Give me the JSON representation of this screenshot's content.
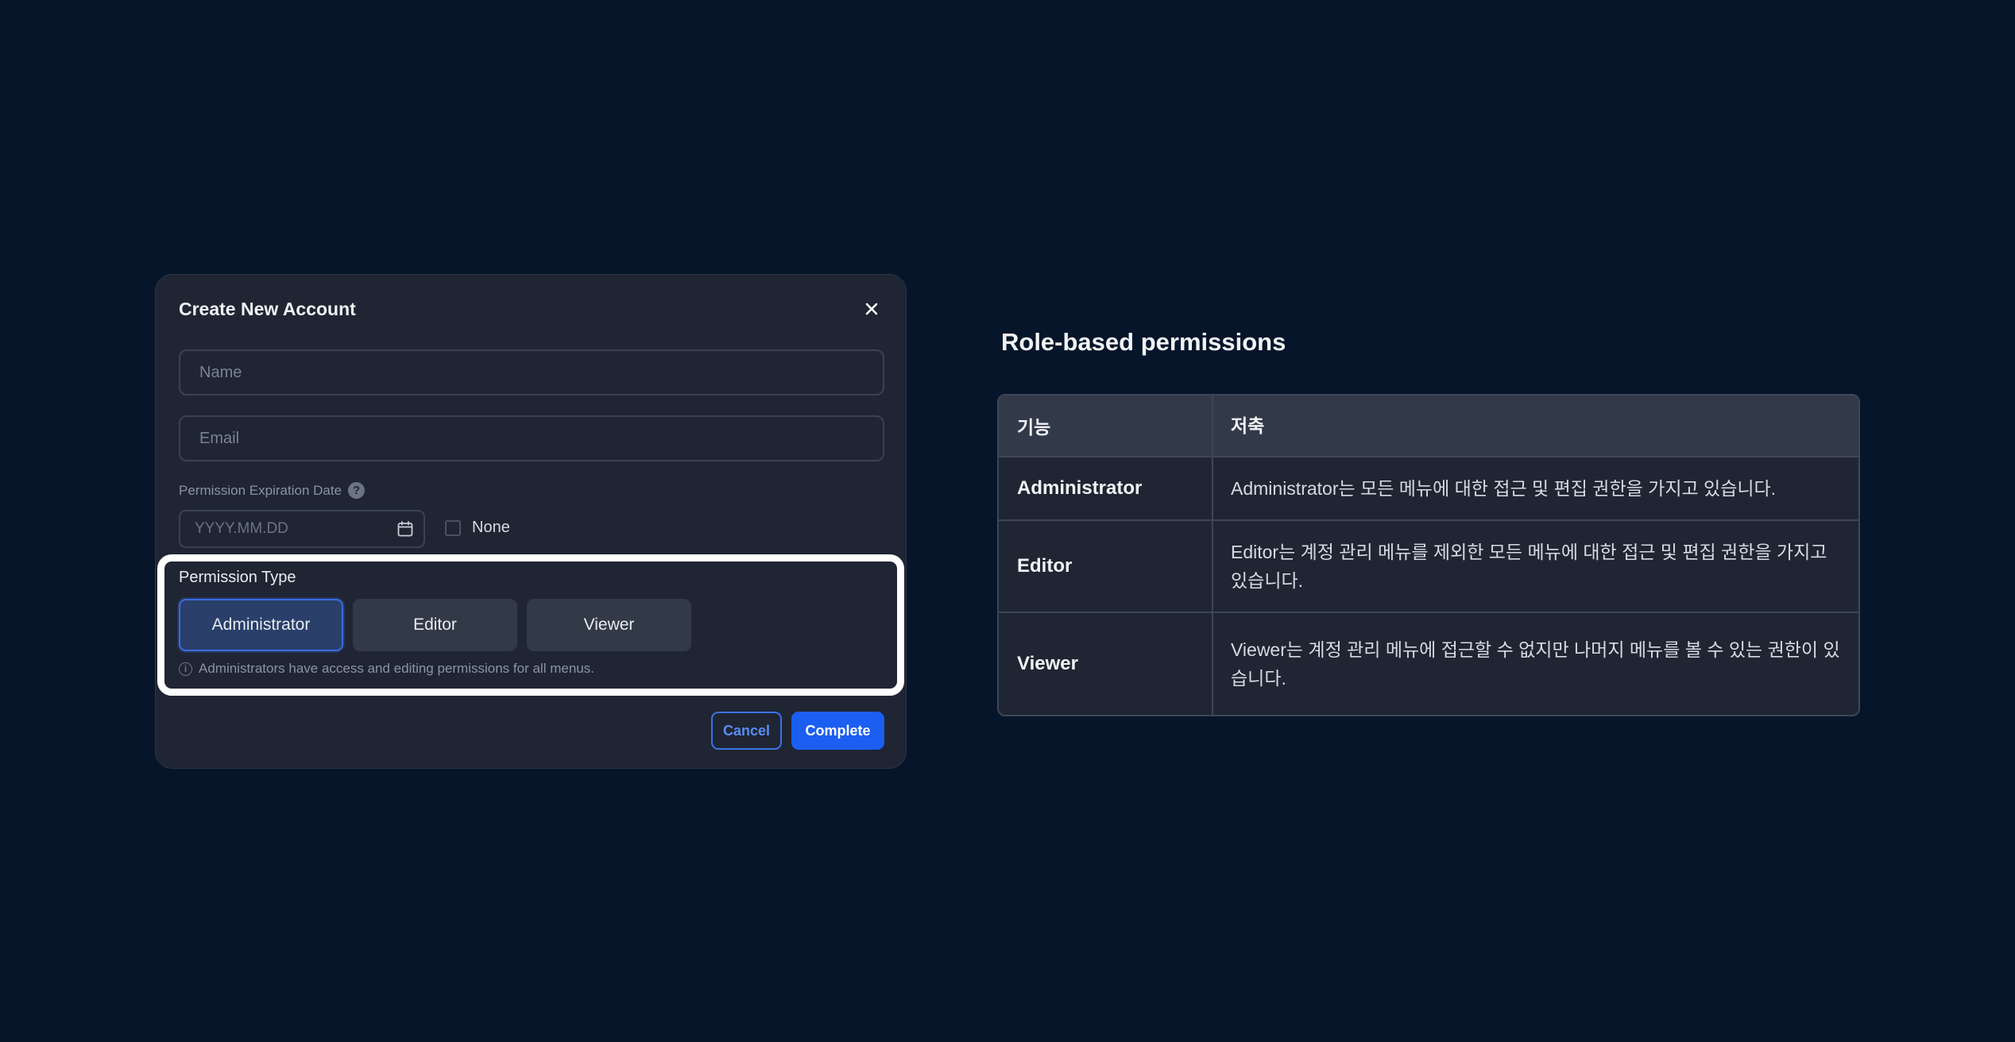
{
  "modal": {
    "title": "Create New Account",
    "name_placeholder": "Name",
    "email_placeholder": "Email",
    "expiration_label": "Permission Expiration Date",
    "date_placeholder": "YYYY.MM.DD",
    "none_label": "None",
    "permission_type_label": "Permission Type",
    "permission_options": [
      "Administrator",
      "Editor",
      "Viewer"
    ],
    "selected_permission": "Administrator",
    "hint": "Administrators have access and editing permissions for all menus.",
    "cancel_label": "Cancel",
    "complete_label": "Complete"
  },
  "permissions": {
    "heading": "Role-based permissions",
    "columns": [
      "기능",
      "저축"
    ],
    "rows": [
      {
        "role": "Administrator",
        "description": "Administrator는 모든 메뉴에 대한 접근 및 편집 권한을 가지고 있습니다."
      },
      {
        "role": "Editor",
        "description": "Editor는 계정 관리 메뉴를 제외한 모든 메뉴에 대한 접근 및 편집 권한을 가지고 있습니다."
      },
      {
        "role": "Viewer",
        "description": "Viewer는 계정 관리 메뉴에 접근할 수 없지만 나머지 메뉴를 볼 수 있는 권한이 있습니다."
      }
    ]
  },
  "colors": {
    "background": "#06152a",
    "modal": "#1f2533",
    "accent": "#1b5ef2"
  }
}
